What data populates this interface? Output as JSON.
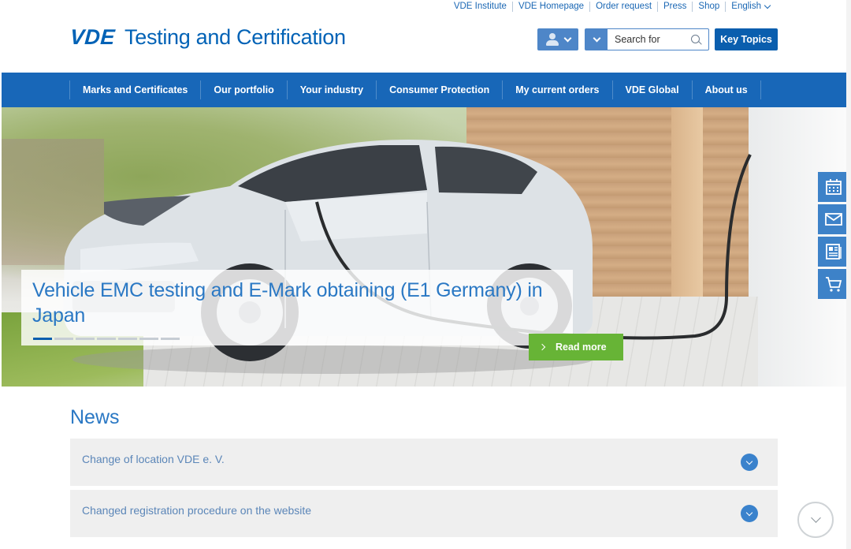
{
  "top_links": [
    "VDE Institute",
    "VDE Homepage",
    "Order request",
    "Press",
    "Shop"
  ],
  "language": "English",
  "logo": {
    "mark": "VDE",
    "tagline": "Testing and Certification"
  },
  "search": {
    "placeholder": "Search for"
  },
  "key_topics_label": "Key Topics",
  "nav": [
    "Marks and Certificates",
    "Our portfolio",
    "Your industry",
    "Consumer Protection",
    "My current orders",
    "VDE Global",
    "About us"
  ],
  "hero": {
    "title": "Vehicle EMC testing and E-Mark obtaining (E1 Germany) in Japan",
    "read_more": "Read more",
    "slides_count": 7,
    "active_slide": 0
  },
  "side_tools": [
    "calendar-icon",
    "mail-icon",
    "newsletter-icon",
    "cart-icon"
  ],
  "news": {
    "title": "News",
    "items": [
      "Change of location VDE e. V.",
      "Changed registration procedure on the website"
    ]
  },
  "colors": {
    "brand": "#0062b6",
    "nav": "#1867b8",
    "accent_green": "#67b436"
  }
}
